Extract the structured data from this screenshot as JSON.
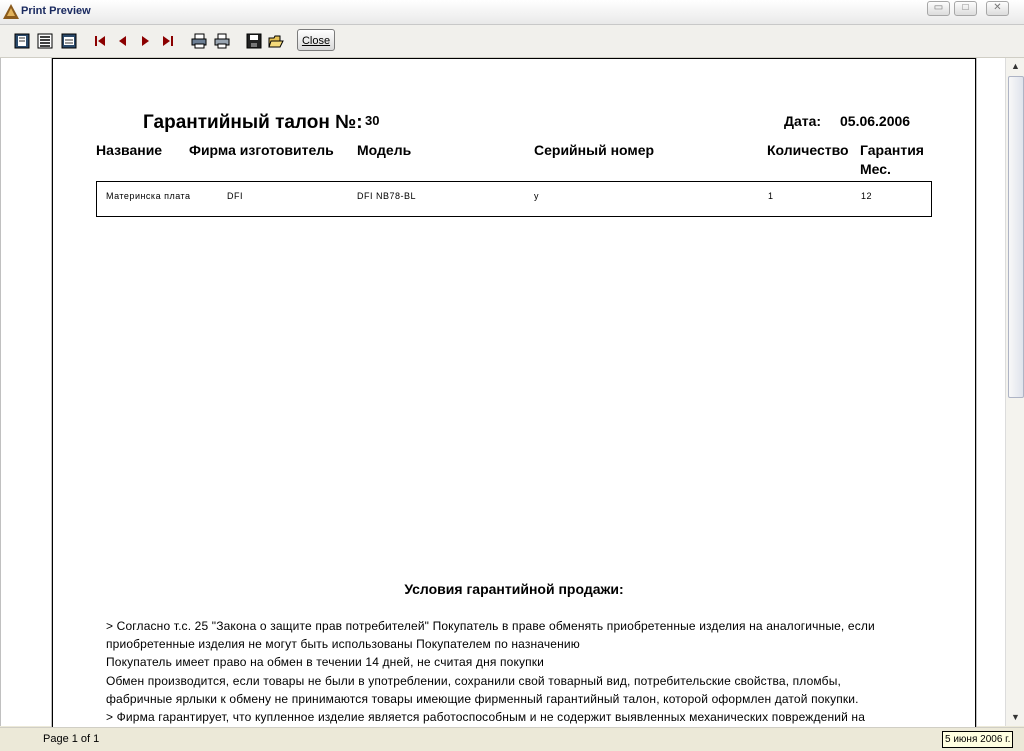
{
  "window": {
    "title": "Print Preview",
    "minimize_glyph": "▭",
    "maximize_glyph": "□",
    "close_glyph": "✕"
  },
  "toolbar": {
    "icons": [
      "one-page-icon",
      "page-width-icon",
      "multi-page-icon",
      "first-page-icon",
      "previous-page-icon",
      "next-page-icon",
      "last-page-icon",
      "printer-setup-icon",
      "print-icon",
      "save-icon",
      "open-icon"
    ],
    "close_label": "Close"
  },
  "document": {
    "title": "Гарантийный талон №:",
    "number": "30",
    "date_label": "Дата:",
    "date_value": "05.06.2006",
    "columns": [
      "Название",
      "Фирма изготовитель",
      "Модель",
      "Серийный номер",
      "Количество",
      "Гарантия Мес."
    ],
    "rows": [
      [
        "Материнска плата",
        "DFI",
        "DFI NB78-BL",
        "у",
        "1",
        "12"
      ]
    ],
    "terms_title": "Условия гарантийной продажи:",
    "terms_lines": [
      "> Согласно т.с. 25 \"Закона о защите прав потребителей\" Покупатель в праве обменять приобретенные изделия на аналогичные, если",
      "приобретенные изделия не могут быть использованы Покупателем по назначению",
      "Покупатель имеет право на обмен в течении 14 дней, не считая дня покупки",
      "Обмен производится, если товары не были в употреблении, сохранили свой товарный вид, потребительские свойства, пломбы,",
      "фабричные ярлыки к обмену не принимаются товары имеющие фирменный гарантийный талон, которой оформлен датой покупки.",
      "> Фирма гарантирует, что купленное изделие является работоспособным и не содержит выявленных механических повреждений на"
    ]
  },
  "status": {
    "page_info": "Page 1 of 1",
    "clock": "5 июня 2006 г."
  },
  "colors": {
    "accent": "#1a2a60",
    "sheet_border": "#000000",
    "clock_bg": "#ffffe1"
  }
}
